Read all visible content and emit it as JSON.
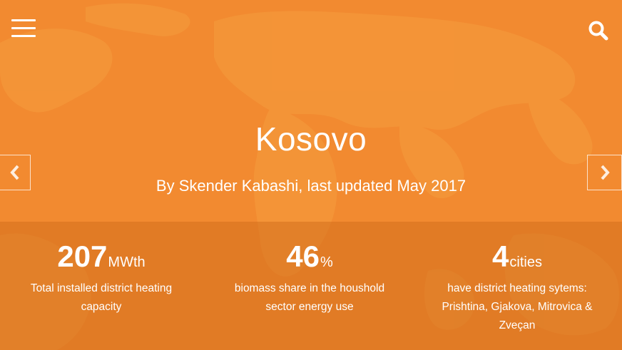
{
  "header": {
    "menu_icon": "hamburger-menu-icon",
    "search_icon": "search-icon"
  },
  "slide": {
    "title": "Kosovo",
    "subtitle": "By Skender Kabashi, last updated May 2017",
    "prev_icon": "chevron-left-icon",
    "next_icon": "chevron-right-icon"
  },
  "stats": [
    {
      "value": "207",
      "unit": "MWth",
      "description": "Total installed district heating capacity"
    },
    {
      "value": "46",
      "unit": "%",
      "description": "biomass share in the houshold sector energy use"
    },
    {
      "value": "4",
      "unit": "cities",
      "description": "have district heating sytems: Prishtina, Gjakova, Mitrovica & Zveçan"
    }
  ],
  "colors": {
    "background": "#f28a30",
    "band": "#d97a2a",
    "text": "#ffffff"
  }
}
